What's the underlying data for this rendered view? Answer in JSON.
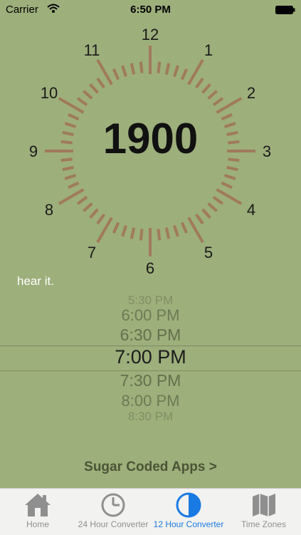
{
  "status_bar": {
    "carrier": "Carrier",
    "time": "6:50 PM"
  },
  "clock": {
    "numbers": [
      "12",
      "1",
      "2",
      "3",
      "4",
      "5",
      "6",
      "7",
      "8",
      "9",
      "10",
      "11"
    ],
    "display": "1900",
    "tick_color": "#a07a5c"
  },
  "hint": "hear it.",
  "picker": {
    "items": [
      "5:30 PM",
      "6:00 PM",
      "6:30 PM",
      "7:00 PM",
      "7:30 PM",
      "8:00 PM",
      "8:30 PM"
    ],
    "selected": "7:00 PM"
  },
  "footer_link": "Sugar Coded Apps >",
  "tabs": [
    {
      "label": "Home",
      "icon": "house-icon"
    },
    {
      "label": "24 Hour Converter",
      "icon": "clock-icon"
    },
    {
      "label": "12 Hour Converter",
      "icon": "half-circle-icon",
      "active": true
    },
    {
      "label": "Time Zones",
      "icon": "map-icon"
    }
  ],
  "colors": {
    "background": "#9daf7b",
    "accent": "#1a7ae3"
  }
}
